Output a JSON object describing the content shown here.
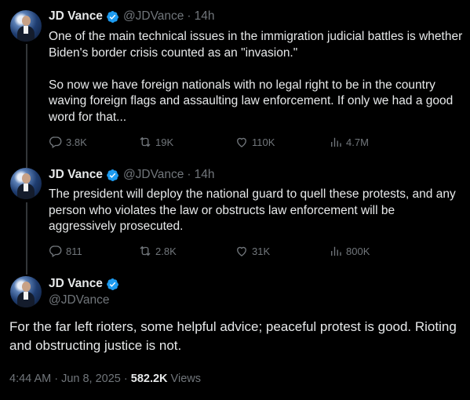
{
  "tweets": [
    {
      "author": "JD Vance",
      "handle": "@JDVance",
      "separator": "·",
      "time": "14h",
      "text_lines": [
        "One of the main technical issues in the immigration judicial battles is whether Biden's border crisis counted as an \"invasion.\"",
        "So now we have foreign nationals with no legal right to be in the country waving foreign flags and assaulting law enforcement. If only we had a good word for that..."
      ],
      "replies": "3.8K",
      "reposts": "19K",
      "likes": "110K",
      "views": "4.7M"
    },
    {
      "author": "JD Vance",
      "handle": "@JDVance",
      "separator": "·",
      "time": "14h",
      "text_lines": [
        "The president will deploy the national guard to quell these protests, and any person who violates the law or obstructs law enforcement will be aggressively prosecuted."
      ],
      "replies": "811",
      "reposts": "2.8K",
      "likes": "31K",
      "views": "800K"
    }
  ],
  "main_tweet": {
    "author": "JD Vance",
    "handle": "@JDVance",
    "text": "For the far left rioters, some helpful advice; peaceful protest is good. Rioting and obstructing justice is not.",
    "date_time": "4:44 AM · Jun 8, 2025 · ",
    "views_count": "582.2K",
    "views_label": " Views"
  },
  "colors": {
    "background": "#000000",
    "text": "#e7e9ea",
    "secondary": "#71767b",
    "verified": "#1d9bf0",
    "thread_line": "#333639"
  },
  "icons": [
    "verified-badge-icon",
    "reply-icon",
    "repost-icon",
    "like-icon",
    "views-icon"
  ]
}
